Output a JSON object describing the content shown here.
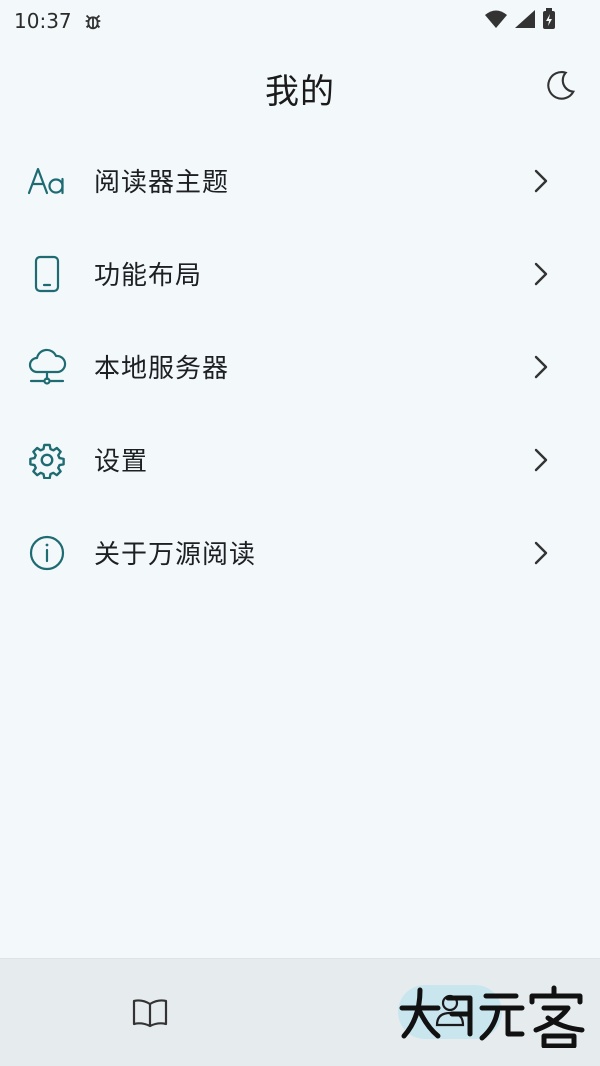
{
  "status": {
    "time": "10:37"
  },
  "header": {
    "title": "我的"
  },
  "menu": [
    {
      "label": "阅读器主题",
      "icon": "font-aa-icon"
    },
    {
      "label": "功能布局",
      "icon": "phone-icon"
    },
    {
      "label": "本地服务器",
      "icon": "cloud-server-icon"
    },
    {
      "label": "设置",
      "icon": "gear-icon"
    },
    {
      "label": "关于万源阅读",
      "icon": "info-icon"
    }
  ],
  "bottom_nav": [
    {
      "icon": "book-open-icon"
    },
    {
      "icon": "person-icon",
      "selected": true
    }
  ],
  "colors": {
    "accent": "#1e6b72",
    "background": "#f3f8fb",
    "nav_bg": "#e6ebee",
    "pill": "#c9e6ef"
  },
  "watermark": {
    "text": "大玩客"
  }
}
